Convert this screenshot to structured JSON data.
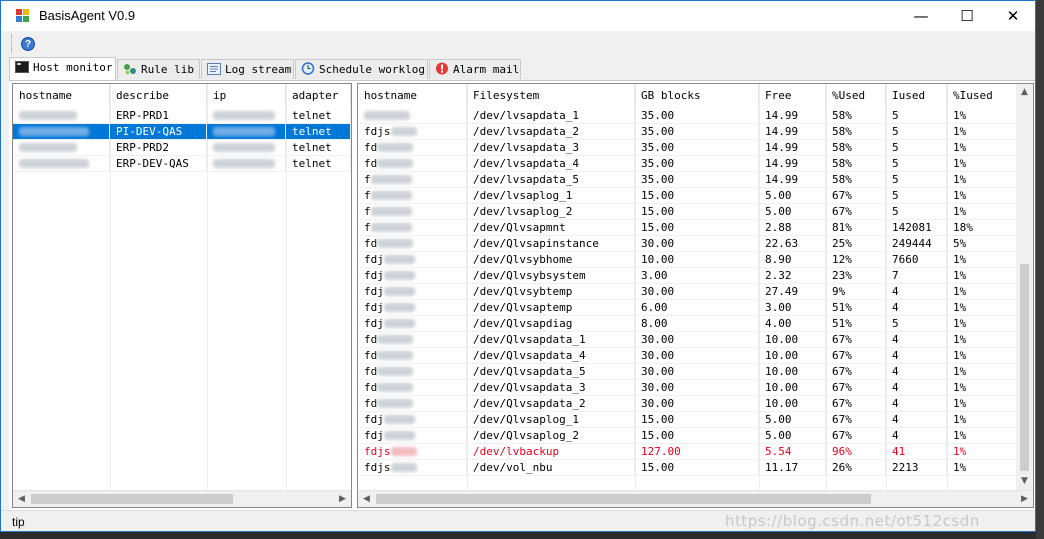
{
  "window": {
    "title": "BasisAgent V0.9",
    "minimize": "—",
    "maximize": "☐",
    "close": "✕"
  },
  "toolbar": {
    "help_icon": "question-circle-icon",
    "help_glyph": "?"
  },
  "tabs": [
    {
      "label": "Host monitor",
      "icon": "terminal-icon"
    },
    {
      "label": "Rule lib",
      "icon": "rules-icon"
    },
    {
      "label": "Log stream",
      "icon": "log-icon"
    },
    {
      "label": "Schedule worklog",
      "icon": "clock-icon"
    },
    {
      "label": "Alarm mail",
      "icon": "alarm-icon"
    }
  ],
  "hosts": {
    "columns": [
      "hostname",
      "describe",
      "ip",
      "adapter"
    ],
    "rows": [
      {
        "describe": "ERP-PRD1",
        "adapter": "telnet",
        "selected": false
      },
      {
        "describe": "PI-DEV-QAS",
        "adapter": "telnet",
        "selected": true
      },
      {
        "describe": "ERP-PRD2",
        "adapter": "telnet",
        "selected": false
      },
      {
        "describe": "ERP-DEV-QAS",
        "adapter": "telnet",
        "selected": false
      }
    ]
  },
  "filesystems": {
    "columns": [
      "hostname",
      "Filesystem",
      "GB blocks",
      "Free",
      "%Used",
      "Iused",
      "%Iused"
    ],
    "rows": [
      {
        "host": "",
        "fs": "/dev/lvsapdata_1",
        "gb": "35.00",
        "free": "14.99",
        "used": "58%",
        "iused": "5",
        "piused": "1%"
      },
      {
        "host": "fdjs",
        "fs": "/dev/lvsapdata_2",
        "gb": "35.00",
        "free": "14.99",
        "used": "58%",
        "iused": "5",
        "piused": "1%"
      },
      {
        "host": "fd",
        "fs": "/dev/lvsapdata_3",
        "gb": "35.00",
        "free": "14.99",
        "used": "58%",
        "iused": "5",
        "piused": "1%"
      },
      {
        "host": "fd",
        "fs": "/dev/lvsapdata_4",
        "gb": "35.00",
        "free": "14.99",
        "used": "58%",
        "iused": "5",
        "piused": "1%"
      },
      {
        "host": "f",
        "fs": "/dev/lvsapdata_5",
        "gb": "35.00",
        "free": "14.99",
        "used": "58%",
        "iused": "5",
        "piused": "1%"
      },
      {
        "host": "f",
        "fs": "/dev/lvsaplog_1",
        "gb": "15.00",
        "free": "5.00",
        "used": "67%",
        "iused": "5",
        "piused": "1%"
      },
      {
        "host": "f",
        "fs": "/dev/lvsaplog_2",
        "gb": "15.00",
        "free": "5.00",
        "used": "67%",
        "iused": "5",
        "piused": "1%"
      },
      {
        "host": "f",
        "fs": "/dev/Qlvsapmnt",
        "gb": "15.00",
        "free": "2.88",
        "used": "81%",
        "iused": "142081",
        "piused": "18%"
      },
      {
        "host": "fd",
        "fs": "/dev/Qlvsapinstance",
        "gb": "30.00",
        "free": "22.63",
        "used": "25%",
        "iused": "249444",
        "piused": "5%"
      },
      {
        "host": "fdj",
        "fs": "/dev/Qlvsybhome",
        "gb": "10.00",
        "free": "8.90",
        "used": "12%",
        "iused": "7660",
        "piused": "1%"
      },
      {
        "host": "fdj",
        "fs": "/dev/Qlvsybsystem",
        "gb": "3.00",
        "free": "2.32",
        "used": "23%",
        "iused": "7",
        "piused": "1%"
      },
      {
        "host": "fdj",
        "fs": "/dev/Qlvsybtemp",
        "gb": "30.00",
        "free": "27.49",
        "used": "9%",
        "iused": "4",
        "piused": "1%"
      },
      {
        "host": "fdj",
        "fs": "/dev/Qlvsaptemp",
        "gb": "6.00",
        "free": "3.00",
        "used": "51%",
        "iused": "4",
        "piused": "1%"
      },
      {
        "host": "fdj",
        "fs": "/dev/Qlvsapdiag",
        "gb": "8.00",
        "free": "4.00",
        "used": "51%",
        "iused": "5",
        "piused": "1%"
      },
      {
        "host": "fd",
        "fs": "/dev/Qlvsapdata_1",
        "gb": "30.00",
        "free": "10.00",
        "used": "67%",
        "iused": "4",
        "piused": "1%"
      },
      {
        "host": "fd",
        "fs": "/dev/Qlvsapdata_4",
        "gb": "30.00",
        "free": "10.00",
        "used": "67%",
        "iused": "4",
        "piused": "1%"
      },
      {
        "host": "fd",
        "fs": "/dev/Qlvsapdata_5",
        "gb": "30.00",
        "free": "10.00",
        "used": "67%",
        "iused": "4",
        "piused": "1%"
      },
      {
        "host": "fd",
        "fs": "/dev/Qlvsapdata_3",
        "gb": "30.00",
        "free": "10.00",
        "used": "67%",
        "iused": "4",
        "piused": "1%"
      },
      {
        "host": "fd",
        "fs": "/dev/Qlvsapdata_2",
        "gb": "30.00",
        "free": "10.00",
        "used": "67%",
        "iused": "4",
        "piused": "1%"
      },
      {
        "host": "fdj",
        "fs": "/dev/Qlvsaplog_1",
        "gb": "15.00",
        "free": "5.00",
        "used": "67%",
        "iused": "4",
        "piused": "1%"
      },
      {
        "host": "fdj",
        "fs": "/dev/Qlvsaplog_2",
        "gb": "15.00",
        "free": "5.00",
        "used": "67%",
        "iused": "4",
        "piused": "1%"
      },
      {
        "host": "fdjs",
        "fs": "/dev/lvbackup",
        "gb": "127.00",
        "free": "5.54",
        "used": "96%",
        "iused": "41",
        "piused": "1%",
        "alarm": true
      },
      {
        "host": "fdjs",
        "fs": "/dev/vol_nbu",
        "gb": "15.00",
        "free": "11.17",
        "used": "26%",
        "iused": "2213",
        "piused": "1%"
      }
    ]
  },
  "status": {
    "text": "tip"
  },
  "watermark": "https://blog.csdn.net/ot512csdn",
  "colors": {
    "selection": "#0078d7",
    "alarm": "#e8001c",
    "window_border": "#1f73c8"
  }
}
